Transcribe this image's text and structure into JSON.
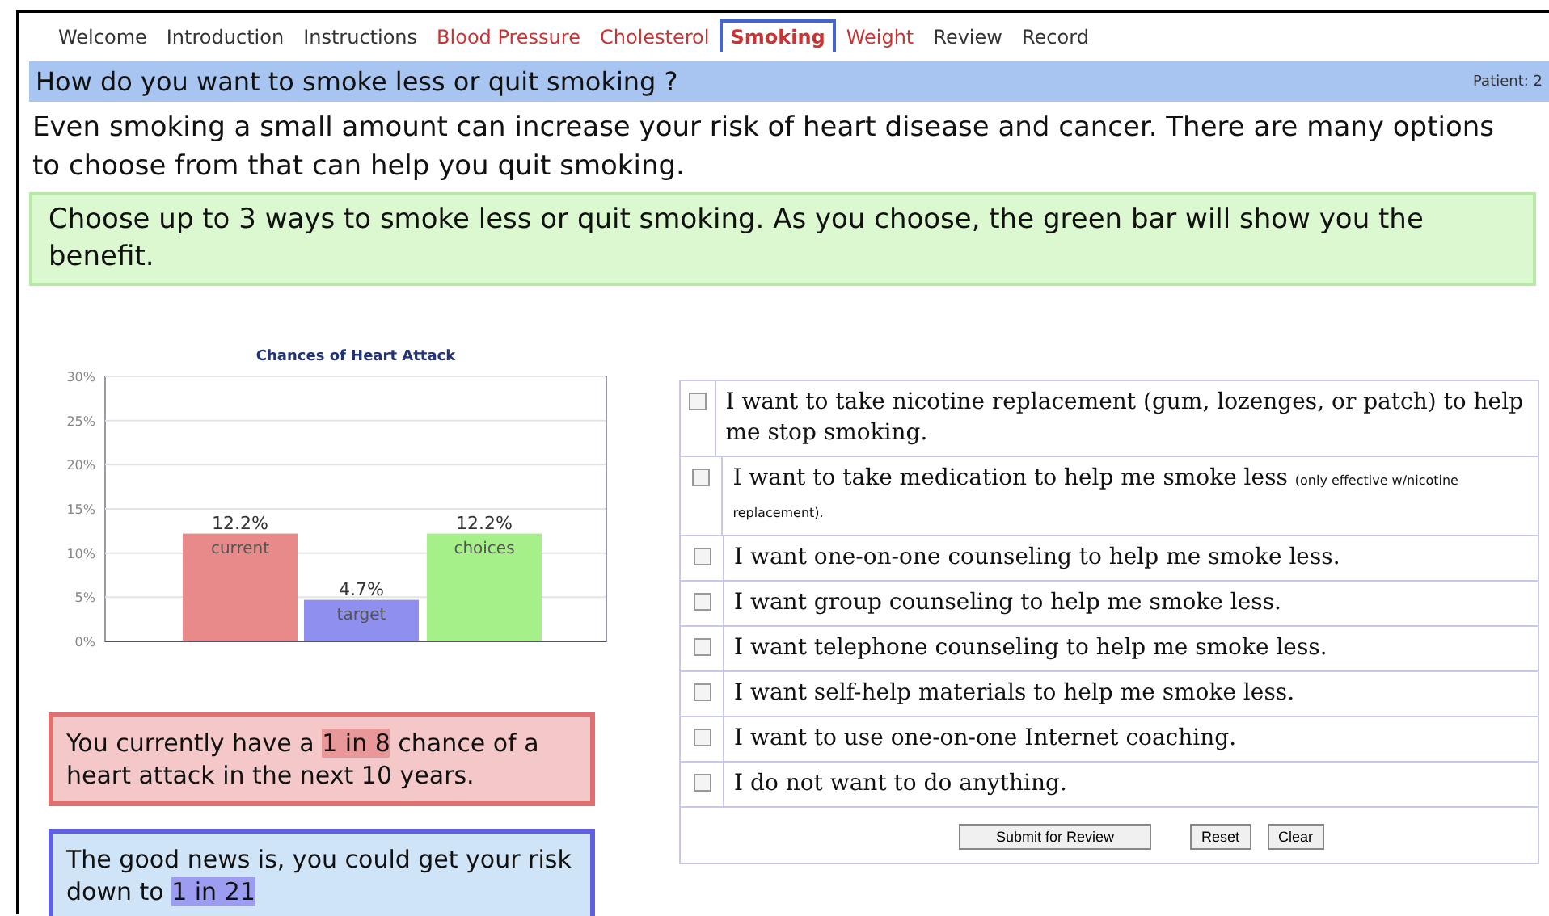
{
  "tabs": [
    {
      "label": "Welcome",
      "selected": false,
      "color": "#333333"
    },
    {
      "label": "Introduction",
      "selected": false,
      "color": "#333333"
    },
    {
      "label": "Instructions",
      "selected": false,
      "color": "#333333"
    },
    {
      "label": "Blood Pressure",
      "selected": false,
      "color": "#cc3333"
    },
    {
      "label": "Cholesterol",
      "selected": false,
      "color": "#cc3333"
    },
    {
      "label": "Smoking",
      "selected": true,
      "color": "#cc3333"
    },
    {
      "label": "Weight",
      "selected": false,
      "color": "#cc3333"
    },
    {
      "label": "Review",
      "selected": false,
      "color": "#333333"
    },
    {
      "label": "Record",
      "selected": false,
      "color": "#333333"
    }
  ],
  "header": {
    "title": "How do you want to smoke less or quit smoking ?",
    "patient": "Patient: 2"
  },
  "intro": "Even smoking a small amount can increase your risk of heart disease and cancer. There are many options to choose from that can help you quit smoking.",
  "instruction": "Choose up to 3 ways to smoke less or quit smoking. As you choose, the green bar will show you the benefit.",
  "chart": {
    "chart_data": {
      "type": "bar",
      "title": "Chances of Heart Attack",
      "grid": true,
      "series": [
        {
          "name": "current",
          "color": "#e88a8a",
          "values": [
            12.2,
            null,
            null
          ]
        },
        {
          "name": "target",
          "color": "#8f8ff0",
          "values": [
            null,
            4.7,
            null
          ]
        },
        {
          "name": "choices",
          "color": "#a6f08a",
          "values": [
            null,
            null,
            12.2
          ]
        }
      ],
      "ylim": [
        0,
        30
      ],
      "yticks": [
        {
          "value": 0,
          "label": "0%"
        },
        {
          "value": 5,
          "label": "5%"
        },
        {
          "value": 10,
          "label": "10%"
        },
        {
          "value": 15,
          "label": "15%"
        },
        {
          "value": 20,
          "label": "20%"
        },
        {
          "value": 25,
          "label": "25%"
        },
        {
          "value": 30,
          "label": "30%"
        }
      ],
      "value_labels": [
        "12.2%",
        "4.7%",
        "12.2%"
      ]
    }
  },
  "current_risk": {
    "before": "You currently have a ",
    "highlight": "1 in 8",
    "after": " chance of a heart attack in the next 10 years."
  },
  "goal_risk": {
    "before": "The good news is, you could get your risk down to ",
    "highlight": "1 in 21"
  },
  "options": [
    {
      "text": "I want to take nicotine replacement (gum, lozenges, or patch) to help me stop smoking.",
      "checked": false
    },
    {
      "text": "I want to take medication to help me smoke less",
      "note": "(only effective w/nicotine replacement).",
      "checked": false
    },
    {
      "text": "I want one-on-one counseling to help me smoke less.",
      "checked": false
    },
    {
      "text": "I want group counseling to help me smoke less.",
      "checked": false
    },
    {
      "text": "I want telephone counseling to help me smoke less.",
      "checked": false
    },
    {
      "text": "I want self-help materials to help me smoke less.",
      "checked": false
    },
    {
      "text": "I want to use one-on-one Internet coaching.",
      "checked": false
    },
    {
      "text": "I do not want to do anything.",
      "checked": false
    }
  ],
  "buttons": [
    "Submit for Review",
    "Reset",
    "Clear"
  ]
}
